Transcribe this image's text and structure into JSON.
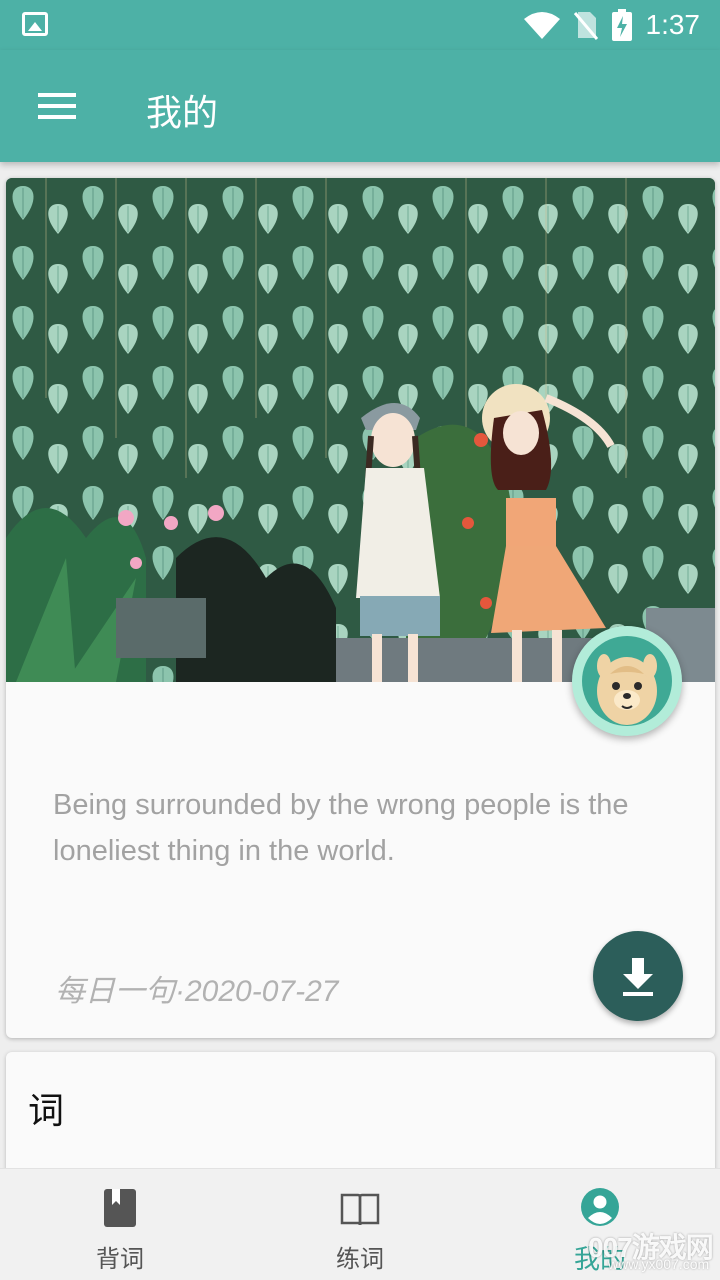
{
  "status_bar": {
    "time": "1:37",
    "icons": [
      "image-notification-icon",
      "wifi-icon",
      "no-sim-icon",
      "battery-charging-icon"
    ]
  },
  "app_bar": {
    "title": "我的",
    "menu_icon": "menu-icon"
  },
  "daily_card": {
    "image_description_icon": "illustration-two-girls-leaves",
    "avatar_icon": "alpaca-avatar-icon",
    "quote": "Being surrounded by the wrong people is the loneliest thing in the world.",
    "date_label": "每日一句·2020-07-27",
    "download_icon": "download-icon"
  },
  "word_card": {
    "title": "词"
  },
  "bottom_nav": {
    "items": [
      {
        "label": "背词",
        "icon": "book-icon",
        "active": false
      },
      {
        "label": "练词",
        "icon": "open-book-icon",
        "active": false
      },
      {
        "label": "我的",
        "icon": "profile-icon",
        "active": true
      }
    ]
  },
  "watermark": {
    "main": "007游戏网",
    "sub": "www.yx007.com"
  },
  "colors": {
    "primary": "#4db1a6",
    "accent_dark": "#2c5e5a",
    "active_nav": "#35a597",
    "quote_text": "#a2a2a2"
  }
}
